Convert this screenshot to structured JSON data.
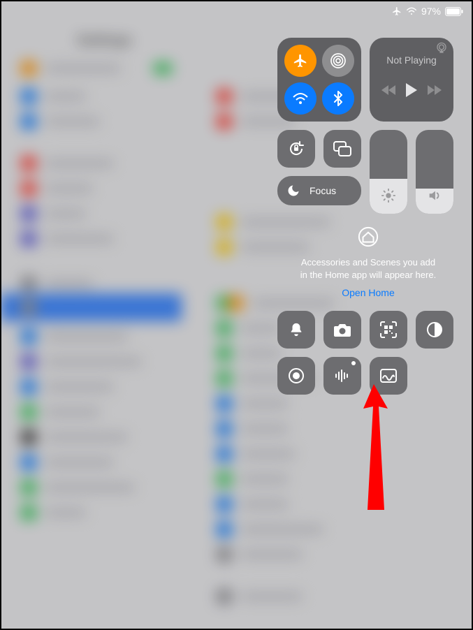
{
  "status": {
    "battery_text": "97%"
  },
  "connectivity": {
    "airplane": true,
    "airdrop": false,
    "wifi": true,
    "bluetooth": true
  },
  "media": {
    "title": "Not Playing"
  },
  "focus": {
    "label": "Focus"
  },
  "sliders": {
    "brightness_pct": 42,
    "volume_pct": 30
  },
  "home": {
    "message_l1": "Accessories and Scenes you add",
    "message_l2": "in the Home app will appear here.",
    "link_label": "Open Home"
  },
  "shortcuts": {
    "row1": [
      "silent-mode",
      "camera",
      "qr-scanner",
      "dark-mode"
    ],
    "row2": [
      "screen-record",
      "voice-memos",
      "freeform"
    ]
  }
}
